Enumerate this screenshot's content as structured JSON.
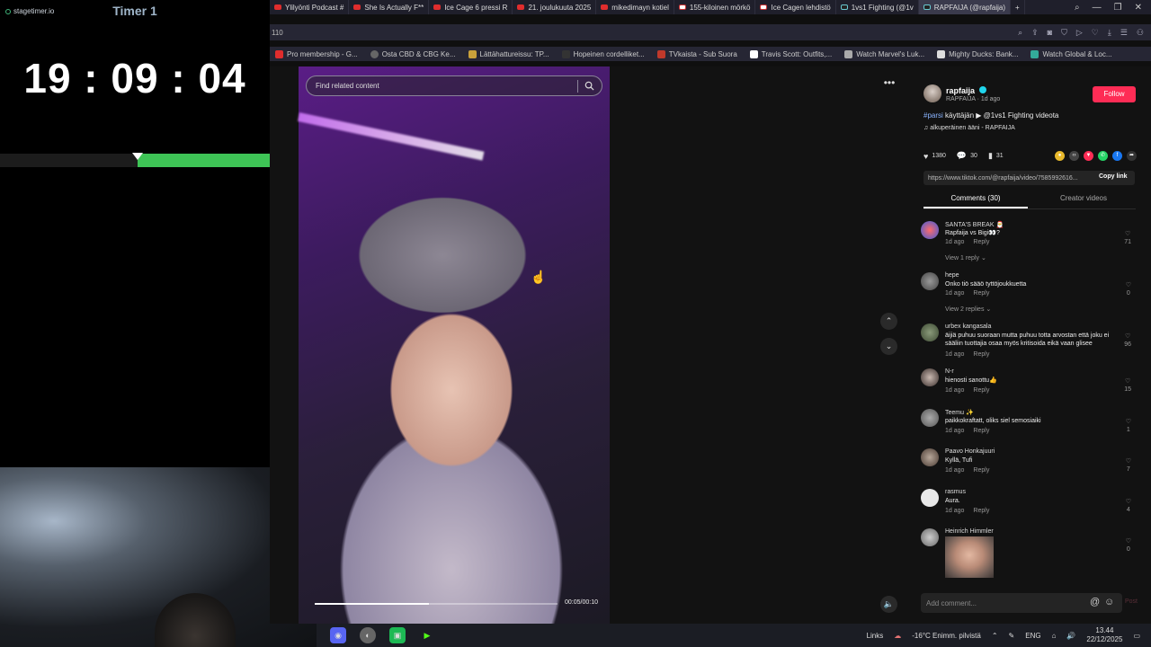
{
  "timer": {
    "brand": "stagetimer.io",
    "title": "Timer 1",
    "time": "19 : 09 : 04",
    "progress_fraction": 0.49,
    "accent_color": "#3ec456"
  },
  "browser": {
    "tabs": [
      {
        "label": "Ylilyönti Podcast #",
        "icon": "youtube-icon"
      },
      {
        "label": "She Is Actually F**",
        "icon": "youtube-icon"
      },
      {
        "label": "Ice Cage 6 pressi R",
        "icon": "youtube-icon"
      },
      {
        "label": "21. joulukuuta 2025",
        "icon": "youtube-icon"
      },
      {
        "label": "mikedimayn kotiel",
        "icon": "youtube-icon"
      },
      {
        "label": "155-kiloinen mörkö",
        "icon": "wiki-icon"
      },
      {
        "label": "Ice Cagen lehdistö",
        "icon": "wiki-icon"
      },
      {
        "label": "1vs1 Fighting (@1v",
        "icon": "tiktok-icon"
      },
      {
        "label": "RAPFAIJA (@rapfaija)",
        "icon": "tiktok-icon"
      }
    ],
    "address_fragment": "110",
    "bookmarks": [
      "Pro membership - G...",
      "Osta CBD & CBG Ke...",
      "Lättähattureissu: TP...",
      "Hopeinen cordelliket...",
      "TVkaista - Sub Suora",
      "Travis Scott: Outfits,...",
      "Watch Marvel's Luk...",
      "Mighty Ducks: Bank...",
      "Watch Global & Loc..."
    ]
  },
  "video": {
    "search_placeholder": "Find related content",
    "time": "00:05/00:10",
    "progress_fraction": 0.47
  },
  "post": {
    "author": "rapfaija",
    "author_sub": "RAPFAIJA · 1d ago",
    "follow_label": "Follow",
    "desc_tag": "#parsi",
    "desc_text": " käyttäjän ▶ @1vs1 Fighting videota",
    "sound": "♫ alkuperäinen ääni - RAPFAIJA",
    "likes": "1380",
    "comments_count": "30",
    "saves": "31",
    "link": "https://www.tiktok.com/@rapfaija/video/7585992616...",
    "copy_link": "Copy link",
    "tab_comments": "Comments (30)",
    "tab_creator": "Creator videos",
    "add_comment_placeholder": "Add comment...",
    "post_label": "Post"
  },
  "comments": [
    {
      "user": "SANTA'S BREAK 🎅",
      "text": "Rapfaija vs Bigi👀?",
      "time": "1d ago",
      "reply": "Reply",
      "likes": "71",
      "view": "View 1 reply ⌄"
    },
    {
      "user": "hepe",
      "text": "Onko tiö sääö tyttöjoukkuetta",
      "time": "1d ago",
      "reply": "Reply",
      "likes": "0",
      "view": "View 2 replies ⌄"
    },
    {
      "user": "urbex kangasala",
      "text": "äijiä puhuu suoraan mutta puhuu totta arvostan että joku ei sääliin tuottajia osaa myös kritisoida eikä vaan glisee",
      "time": "1d ago",
      "reply": "Reply",
      "likes": "96",
      "view": ""
    },
    {
      "user": "N-r",
      "text": "hienosti sanottu👍",
      "time": "1d ago",
      "reply": "Reply",
      "likes": "15",
      "view": ""
    },
    {
      "user": "Teemu ✨",
      "text": "paikkokraftatt, oliks siel semosiaiki",
      "time": "1d ago",
      "reply": "Reply",
      "likes": "1",
      "view": ""
    },
    {
      "user": "Paavo Honkajuuri",
      "text": "Kyllä, Tufi",
      "time": "1d ago",
      "reply": "Reply",
      "likes": "7",
      "view": ""
    },
    {
      "user": "rasmus",
      "text": "Aura.",
      "time": "1d ago",
      "reply": "Reply",
      "likes": "4",
      "view": ""
    },
    {
      "user": "Heinrich Himmler",
      "text": "",
      "time": "",
      "reply": "",
      "likes": "0",
      "view": ""
    }
  ],
  "taskbar": {
    "links": "Links",
    "weather": "-16°C  Enimm. pilvistä",
    "lang": "ENG",
    "time": "13.44",
    "date": "22/12/2025"
  }
}
